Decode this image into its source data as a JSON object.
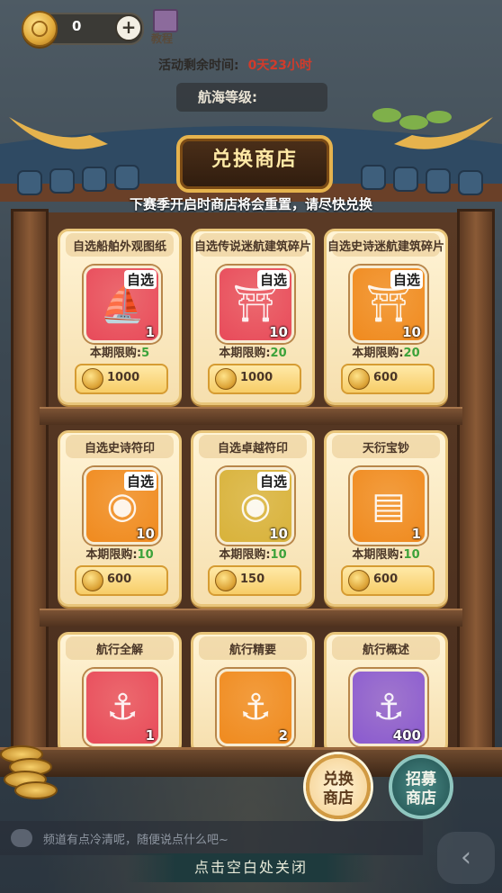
{
  "topbar": {
    "coin_value": "0",
    "plus_icon": "plus-icon",
    "tutorial_label": "教程",
    "remaining_label": "活动剩余时间:",
    "remaining_value": "0天23小时",
    "nav_level_label": "航海等级:"
  },
  "shop": {
    "title": "兑换商店",
    "notice": "下赛季开启时商店将会重置，请尽快兑换",
    "limit_label": "本期限购:",
    "items": [
      {
        "name": "自选船舶外观图纸",
        "badge": "自选",
        "count": "1",
        "limit": "5",
        "price": "1000",
        "icon": "ship-icon",
        "color": "#e84a5a"
      },
      {
        "name": "自选传说迷航建筑碎片",
        "badge": "自选",
        "count": "10",
        "limit": "20",
        "price": "1000",
        "icon": "building-icon",
        "color": "#e84a5a"
      },
      {
        "name": "自选史诗迷航建筑碎片",
        "badge": "自选",
        "count": "10",
        "limit": "20",
        "price": "600",
        "icon": "building-icon",
        "color": "#f08a1e"
      },
      {
        "name": "自选史诗符印",
        "badge": "自选",
        "count": "10",
        "limit": "10",
        "price": "600",
        "icon": "pouch-icon",
        "color": "#f08a1e"
      },
      {
        "name": "自选卓越符印",
        "badge": "自选",
        "count": "10",
        "limit": "10",
        "price": "150",
        "icon": "pouch-icon",
        "color": "#d8b23a"
      },
      {
        "name": "天衍宝钞",
        "badge": "",
        "count": "1",
        "limit": "10",
        "price": "600",
        "icon": "banknote-icon",
        "color": "#f08a1e"
      },
      {
        "name": "航行全解",
        "badge": "",
        "count": "1",
        "limit": "",
        "price": "",
        "icon": "anchor-book-icon",
        "color": "#e84a5a"
      },
      {
        "name": "航行精要",
        "badge": "",
        "count": "2",
        "limit": "",
        "price": "",
        "icon": "anchor-book-icon",
        "color": "#f08a1e"
      },
      {
        "name": "航行概述",
        "badge": "",
        "count": "400",
        "limit": "",
        "price": "",
        "icon": "anchor-book-icon",
        "color": "#8a5ad0"
      }
    ]
  },
  "buttons": {
    "exchange_shop": "兑换\n商店",
    "recruit_shop": "招募\n商店"
  },
  "chat": {
    "placeholder": "频道有点冷清呢，随便说点什么吧~"
  },
  "close_hint": "点击空白处关闭"
}
